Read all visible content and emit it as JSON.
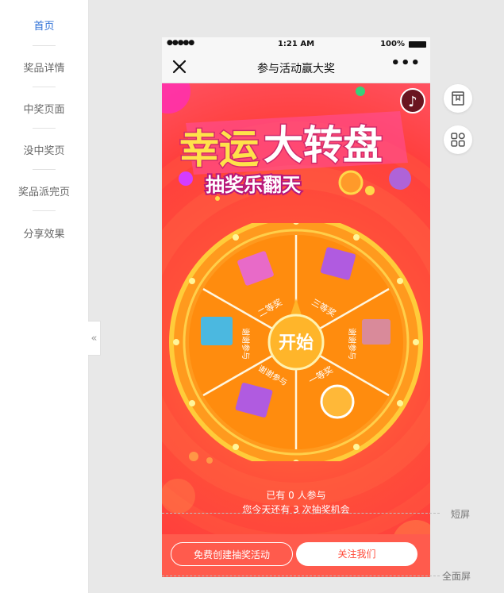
{
  "sidebar": {
    "items": [
      {
        "label": "首页",
        "active": true
      },
      {
        "label": "奖品详情",
        "active": false
      },
      {
        "label": "中奖页面",
        "active": false
      },
      {
        "label": "没中奖页",
        "active": false
      },
      {
        "label": "奖品派完页",
        "active": false
      },
      {
        "label": "分享效果",
        "active": false
      }
    ],
    "collapse_label": "«"
  },
  "phone": {
    "status": {
      "signal": "●●●●●",
      "time": "1:21 AM",
      "battery": "100%"
    },
    "navbar": {
      "title": "参与活动赢大奖",
      "close_icon": "close-icon",
      "more_label": "•••"
    },
    "music_icon": "♪",
    "banner": {
      "title_part1": "幸运",
      "title_part2": "大转盘",
      "subtitle": "抽奖乐翻天"
    },
    "wheel": {
      "start_label": "开始",
      "prizes": [
        "二等奖",
        "三等奖",
        "谢谢参与",
        "谢谢参与",
        "谢谢参与",
        "一等奖"
      ]
    },
    "stats": {
      "participants": "已有 0 人参与",
      "chances": "您今天还有 3 次抽奖机会"
    },
    "buttons": {
      "create": "免费创建抽奖活动",
      "follow": "关注我们"
    }
  },
  "markers": {
    "short": "短屏",
    "full": "全面屏"
  },
  "colors": {
    "accent": "#2d6fd6",
    "hero": "#ff4f3a",
    "wheel": "#ff9a1e",
    "button_text": "#ff4b3a"
  }
}
